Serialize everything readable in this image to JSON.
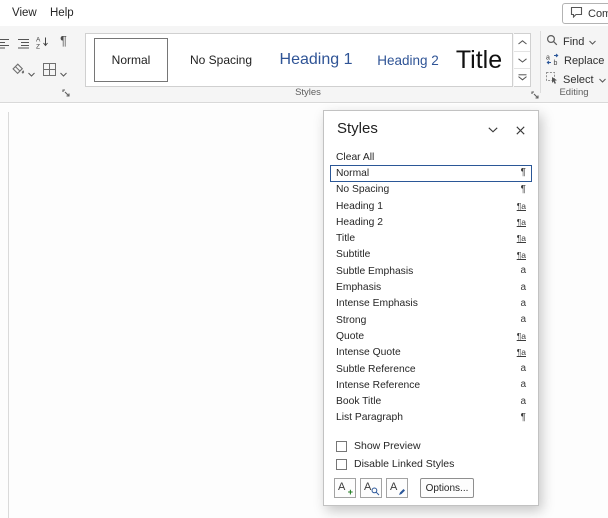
{
  "menubar": {
    "items": [
      {
        "label": "View"
      },
      {
        "label": "Help"
      }
    ],
    "comments_label": "Comm"
  },
  "ribbon": {
    "paragraph_icons": {
      "pilcrow": "¶"
    },
    "style_gallery": {
      "items": [
        {
          "label": "Normal",
          "class": "g-normal",
          "selected": true
        },
        {
          "label": "No Spacing",
          "class": "g-nospacing"
        },
        {
          "label": "Heading 1",
          "class": "g-h1"
        },
        {
          "label": "Heading 2",
          "class": "g-h2"
        },
        {
          "label": "Title",
          "class": "g-title"
        }
      ]
    },
    "styles_group_label": "Styles",
    "editing": {
      "label": "Editing",
      "find": "Find",
      "replace": "Replace",
      "select": "Select"
    }
  },
  "styles_pane": {
    "title": "Styles",
    "clear_all": "Clear All",
    "styles": [
      {
        "name": "Normal",
        "symbol": "¶",
        "kind": "para",
        "selected": true
      },
      {
        "name": "No Spacing",
        "symbol": "¶",
        "kind": "para"
      },
      {
        "name": "Heading 1",
        "symbol": "¶a",
        "kind": "linked"
      },
      {
        "name": "Heading 2",
        "symbol": "¶a",
        "kind": "linked"
      },
      {
        "name": "Title",
        "symbol": "¶a",
        "kind": "linked"
      },
      {
        "name": "Subtitle",
        "symbol": "¶a",
        "kind": "linked"
      },
      {
        "name": "Subtle Emphasis",
        "symbol": "a",
        "kind": "char"
      },
      {
        "name": "Emphasis",
        "symbol": "a",
        "kind": "char"
      },
      {
        "name": "Intense Emphasis",
        "symbol": "a",
        "kind": "char"
      },
      {
        "name": "Strong",
        "symbol": "a",
        "kind": "char"
      },
      {
        "name": "Quote",
        "symbol": "¶a",
        "kind": "linked"
      },
      {
        "name": "Intense Quote",
        "symbol": "¶a",
        "kind": "linked"
      },
      {
        "name": "Subtle Reference",
        "symbol": "a",
        "kind": "char"
      },
      {
        "name": "Intense Reference",
        "symbol": "a",
        "kind": "char"
      },
      {
        "name": "Book Title",
        "symbol": "a",
        "kind": "char"
      },
      {
        "name": "List Paragraph",
        "symbol": "¶",
        "kind": "para"
      }
    ],
    "show_preview": "Show Preview",
    "show_preview_checked": false,
    "disable_linked_styles": "Disable Linked Styles",
    "disable_linked_checked": false,
    "options_button": "Options..."
  },
  "colors": {
    "heading_blue": "#2F5496",
    "selection_border": "#2b5797",
    "ribbon_background": "#f5f5f5"
  }
}
